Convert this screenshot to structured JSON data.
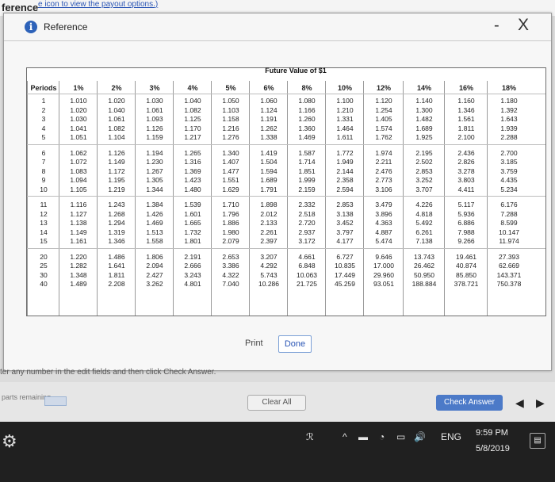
{
  "background": {
    "title": "ference",
    "link_text": "e icon to view the payout options.)",
    "instruction": "ter any number in the edit fields and then click Check Answer.",
    "parts_label": "parts remaining",
    "clear_all": "Clear All",
    "check_answer": "Check Answer"
  },
  "modal": {
    "title": "Reference",
    "minimize": "-",
    "close": "X",
    "print": "Print",
    "done": "Done"
  },
  "fv_table": {
    "title": "Future Value of $1",
    "header": [
      "Periods",
      "1%",
      "2%",
      "3%",
      "4%",
      "5%",
      "6%",
      "8%",
      "10%",
      "12%",
      "14%",
      "16%",
      "18%"
    ],
    "periods": [
      "1",
      "2",
      "3",
      "4",
      "5",
      "6",
      "7",
      "8",
      "9",
      "10",
      "11",
      "12",
      "13",
      "14",
      "15",
      "20",
      "25",
      "30",
      "40"
    ],
    "columns": [
      [
        "1.010",
        "1.020",
        "1.030",
        "1.041",
        "1.051",
        "1.062",
        "1.072",
        "1.083",
        "1.094",
        "1.105",
        "1.116",
        "1.127",
        "1.138",
        "1.149",
        "1.161",
        "1.220",
        "1.282",
        "1.348",
        "1.489"
      ],
      [
        "1.020",
        "1.040",
        "1.061",
        "1.082",
        "1.104",
        "1.126",
        "1.149",
        "1.172",
        "1.195",
        "1.219",
        "1.243",
        "1.268",
        "1.294",
        "1.319",
        "1.346",
        "1.486",
        "1.641",
        "1.811",
        "2.208"
      ],
      [
        "1.030",
        "1.061",
        "1.093",
        "1.126",
        "1.159",
        "1.194",
        "1.230",
        "1.267",
        "1.305",
        "1.344",
        "1.384",
        "1.426",
        "1.469",
        "1.513",
        "1.558",
        "1.806",
        "2.094",
        "2.427",
        "3.262"
      ],
      [
        "1.040",
        "1.082",
        "1.125",
        "1.170",
        "1.217",
        "1.265",
        "1.316",
        "1.369",
        "1.423",
        "1.480",
        "1.539",
        "1.601",
        "1.665",
        "1.732",
        "1.801",
        "2.191",
        "2.666",
        "3.243",
        "4.801"
      ],
      [
        "1.050",
        "1.103",
        "1.158",
        "1.216",
        "1.276",
        "1.340",
        "1.407",
        "1.477",
        "1.551",
        "1.629",
        "1.710",
        "1.796",
        "1.886",
        "1.980",
        "2.079",
        "2.653",
        "3.386",
        "4.322",
        "7.040"
      ],
      [
        "1.060",
        "1.124",
        "1.191",
        "1.262",
        "1.338",
        "1.419",
        "1.504",
        "1.594",
        "1.689",
        "1.791",
        "1.898",
        "2.012",
        "2.133",
        "2.261",
        "2.397",
        "3.207",
        "4.292",
        "5.743",
        "10.286"
      ],
      [
        "1.080",
        "1.166",
        "1.260",
        "1.360",
        "1.469",
        "1.587",
        "1.714",
        "1.851",
        "1.999",
        "2.159",
        "2.332",
        "2.518",
        "2.720",
        "2.937",
        "3.172",
        "4.661",
        "6.848",
        "10.063",
        "21.725"
      ],
      [
        "1.100",
        "1.210",
        "1.331",
        "1.464",
        "1.611",
        "1.772",
        "1.949",
        "2.144",
        "2.358",
        "2.594",
        "2.853",
        "3.138",
        "3.452",
        "3.797",
        "4.177",
        "6.727",
        "10.835",
        "17.449",
        "45.259"
      ],
      [
        "1.120",
        "1.254",
        "1.405",
        "1.574",
        "1.762",
        "1.974",
        "2.211",
        "2.476",
        "2.773",
        "3.106",
        "3.479",
        "3.896",
        "4.363",
        "4.887",
        "5.474",
        "9.646",
        "17.000",
        "29.960",
        "93.051"
      ],
      [
        "1.140",
        "1.300",
        "1.482",
        "1.689",
        "1.925",
        "2.195",
        "2.502",
        "2.853",
        "3.252",
        "3.707",
        "4.226",
        "4.818",
        "5.492",
        "6.261",
        "7.138",
        "13.743",
        "26.462",
        "50.950",
        "188.884"
      ],
      [
        "1.160",
        "1.346",
        "1.561",
        "1.811",
        "2.100",
        "2.436",
        "2.826",
        "3.278",
        "3.803",
        "4.411",
        "5.117",
        "5.936",
        "6.886",
        "7.988",
        "9.266",
        "19.461",
        "40.874",
        "85.850",
        "378.721"
      ],
      [
        "1.180",
        "1.392",
        "1.643",
        "1.939",
        "2.288",
        "2.700",
        "3.185",
        "3.759",
        "4.435",
        "5.234",
        "6.176",
        "7.288",
        "8.599",
        "10.147",
        "11.974",
        "27.393",
        "62.669",
        "143.371",
        "750.378"
      ]
    ]
  },
  "taskbar": {
    "tray_text": "ENG",
    "time": "9:59 PM",
    "date": "5/8/2019"
  }
}
